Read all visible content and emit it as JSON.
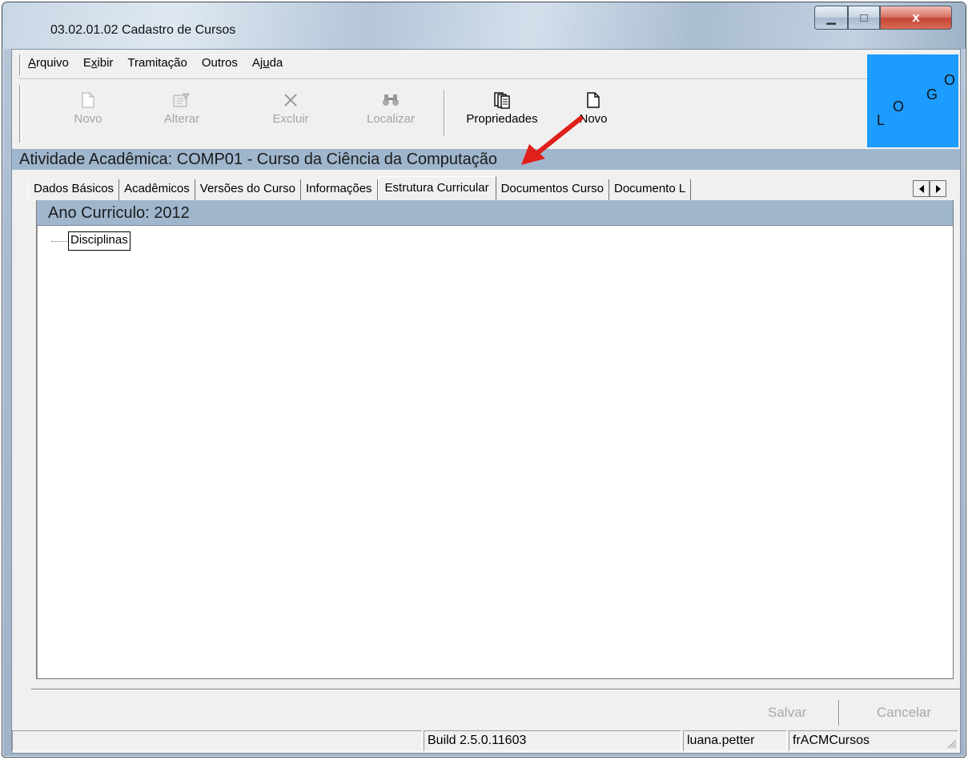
{
  "window": {
    "title": "03.02.01.02 Cadastro de Cursos",
    "controls": {
      "minimize": "▁",
      "maximize": "□",
      "close": "x"
    }
  },
  "menu": [
    {
      "label": "Arquivo",
      "mnemonic_index": 0
    },
    {
      "label": "Exibir",
      "mnemonic_index": 1
    },
    {
      "label": "Tramitação",
      "mnemonic_index": -1
    },
    {
      "label": "Outros",
      "mnemonic_index": -1
    },
    {
      "label": "Ajuda",
      "mnemonic_index": 2
    }
  ],
  "toolbar": {
    "buttons": [
      {
        "label": "Novo",
        "icon": "new-document-icon",
        "enabled": false
      },
      {
        "label": "Alterar",
        "icon": "edit-form-icon",
        "enabled": false
      },
      {
        "label": "Excluir",
        "icon": "delete-x-icon",
        "enabled": false
      },
      {
        "label": "Localizar",
        "icon": "binoculars-icon",
        "enabled": false
      },
      {
        "label": "Propriedades",
        "icon": "pages-icon",
        "enabled": true
      },
      {
        "label": "Novo",
        "icon": "new-document-icon",
        "enabled": true
      }
    ]
  },
  "logo": {
    "letters": [
      "L",
      "O",
      "G",
      "O"
    ],
    "background": "#1c9cff"
  },
  "activity": {
    "text": "Atividade Acadêmica: COMP01 - Curso da Ciência da Computação"
  },
  "tabs": [
    {
      "label": "Dados Básicos",
      "active": false
    },
    {
      "label": "Acadêmicos",
      "active": false
    },
    {
      "label": "Versões do Curso",
      "active": false
    },
    {
      "label": "Informações",
      "active": false
    },
    {
      "label": "Estrutura Curricular",
      "active": true
    },
    {
      "label": "Documentos Curso",
      "active": false
    },
    {
      "label": "Documento L",
      "active": false
    }
  ],
  "panel": {
    "header": "Ano Curriculo: 2012",
    "tree": [
      {
        "label": "Disciplinas"
      }
    ]
  },
  "actions": {
    "save": "Salvar",
    "cancel": "Cancelar"
  },
  "status": {
    "build": "Build 2.5.0.11603",
    "user": "luana.petter",
    "form": "frACMCursos"
  },
  "colors": {
    "header_band": "#9fb6cd",
    "annotation": "#e0201a"
  }
}
